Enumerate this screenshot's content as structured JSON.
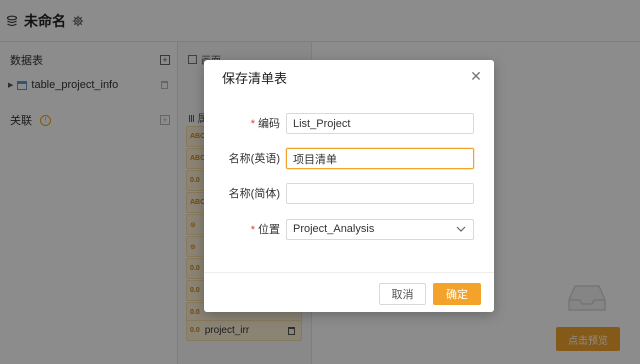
{
  "app": {
    "title": "未命名"
  },
  "left_panel": {
    "tables_header": "数据表",
    "table_name": "table_project_info",
    "relations_header": "关联",
    "info_icon_text": "!"
  },
  "columns_panel": {
    "tab_label": "画面",
    "col_head": "Ⅲ 属",
    "fields": [
      {
        "type": "ABC",
        "name": ""
      },
      {
        "type": "ABC",
        "name": ""
      },
      {
        "type": "0.0",
        "name": ""
      },
      {
        "type": "ABC",
        "name": ""
      },
      {
        "type": "⊙",
        "name": ""
      },
      {
        "type": "⊙",
        "name": ""
      },
      {
        "type": "0.0",
        "name": ""
      },
      {
        "type": "0.0",
        "name": ""
      },
      {
        "type": "0.0",
        "name": ""
      },
      {
        "type": "0.0",
        "name": "project_irr"
      }
    ]
  },
  "preview_button": "点击预览",
  "dialog": {
    "title": "保存清单表",
    "close": "✕",
    "fields": {
      "code_label": "编码",
      "code_value": "List_Project",
      "name_en_label": "名称(英语)",
      "name_en_value": "项目清单",
      "name_zh_label": "名称(简体)",
      "name_zh_value": "",
      "location_label": "位置",
      "location_value": "Project_Analysis"
    },
    "required_mark": "*",
    "cancel_label": "取消",
    "ok_label": "确定"
  },
  "colors": {
    "accent": "#f3a32a",
    "required": "#e53935"
  }
}
